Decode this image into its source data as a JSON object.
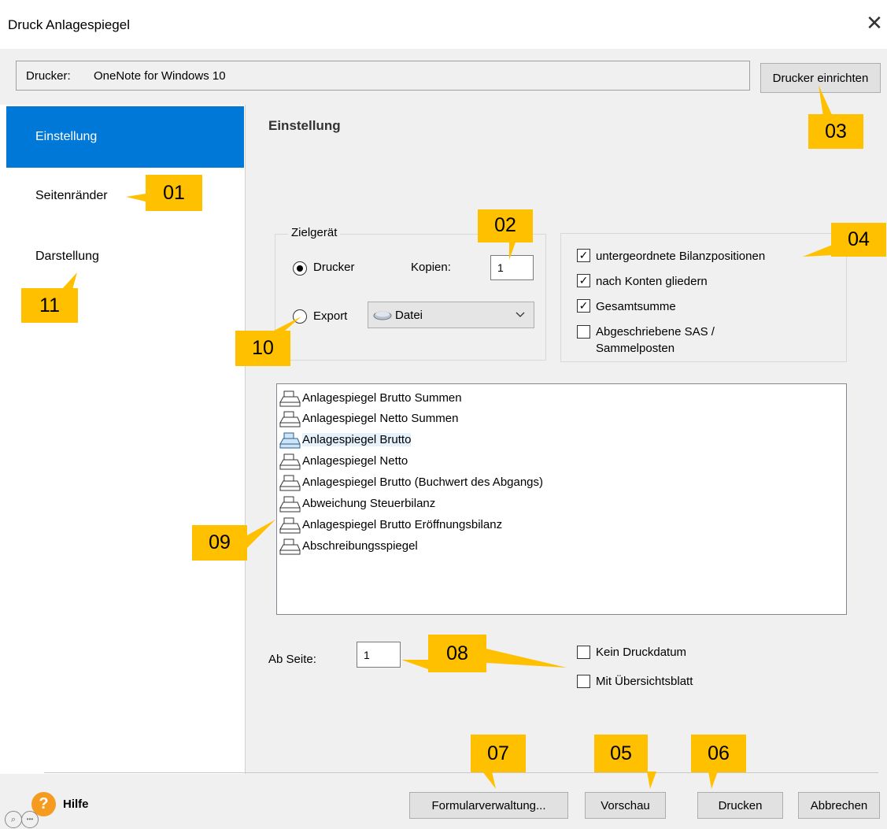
{
  "window": {
    "title": "Druck Anlagespiegel",
    "close_icon": "close-icon"
  },
  "printer": {
    "label": "Drucker:",
    "name": "OneNote for Windows 10",
    "setup_button": "Drucker einrichten"
  },
  "sidebar": {
    "items": [
      {
        "label": "Einstellung",
        "active": true
      },
      {
        "label": "Seitenränder",
        "active": false
      },
      {
        "label": "Darstellung",
        "active": false
      }
    ]
  },
  "main": {
    "section_title": "Einstellung",
    "zielgeraet": {
      "legend": "Zielgerät",
      "drucker_label": "Drucker",
      "drucker_checked": true,
      "kopien_label": "Kopien:",
      "kopien_value": "1",
      "export_label": "Export",
      "export_checked": false,
      "export_select": "Datei"
    },
    "options": [
      {
        "label": "untergeordnete Bilanzpositionen",
        "checked": true
      },
      {
        "label": "nach Konten gliedern",
        "checked": true
      },
      {
        "label": "Gesamtsumme",
        "checked": true
      },
      {
        "label": "Abgeschriebene SAS /",
        "label2": "Sammelposten",
        "checked": false
      }
    ],
    "reports": [
      {
        "label": "Anlagespiegel Brutto Summen",
        "selected": false
      },
      {
        "label": "Anlagespiegel Netto Summen",
        "selected": false
      },
      {
        "label": "Anlagespiegel Brutto",
        "selected": true
      },
      {
        "label": "Anlagespiegel Netto",
        "selected": false
      },
      {
        "label": "Anlagespiegel Brutto (Buchwert des Abgangs)",
        "selected": false
      },
      {
        "label": "Abweichung Steuerbilanz",
        "selected": false
      },
      {
        "label": "Anlagespiegel Brutto Eröffnungsbilanz",
        "selected": false
      },
      {
        "label": "Abschreibungsspiegel",
        "selected": false
      }
    ],
    "ab_seite_label": "Ab Seite:",
    "ab_seite_value": "1",
    "kein_druckdatum": {
      "label": "Kein Druckdatum",
      "checked": false
    },
    "mit_uebersicht": {
      "label": "Mit Übersichtsblatt",
      "checked": false
    }
  },
  "footer": {
    "help_label": "Hilfe",
    "help_icon_glyph": "?",
    "forms_button": "Formularverwaltung...",
    "preview_button": "Vorschau",
    "print_button": "Drucken",
    "cancel_button": "Abbrechen"
  },
  "callouts": [
    "01",
    "02",
    "03",
    "04",
    "05",
    "06",
    "07",
    "08",
    "09",
    "10",
    "11"
  ],
  "colors": {
    "accent": "#0078d7",
    "callout": "#ffc000",
    "help": "#f59b1f"
  }
}
